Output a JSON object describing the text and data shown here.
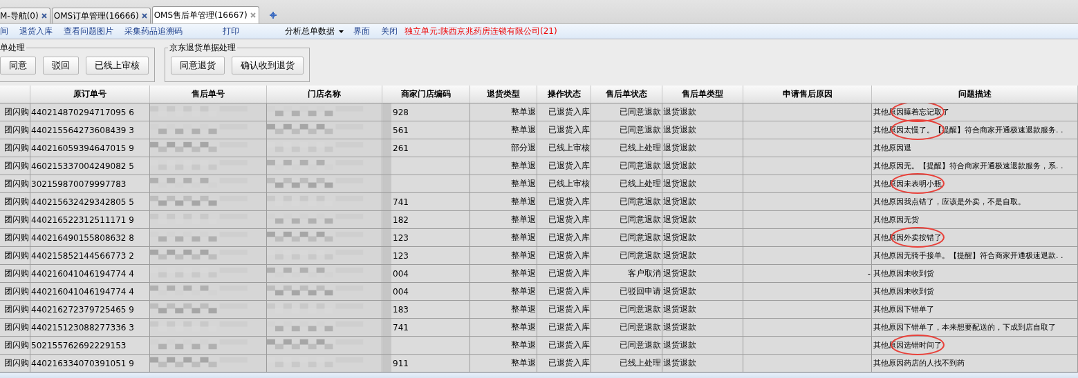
{
  "tabs": [
    {
      "label": "M-导航(0)",
      "selected": false,
      "closable": true
    },
    {
      "label": "OMS订单管理(16666)",
      "selected": false,
      "closable": true
    },
    {
      "label": "OMS售后单管理(16667)",
      "selected": true,
      "closable": true
    }
  ],
  "toolbar": [
    {
      "kind": "link",
      "label": "间"
    },
    {
      "kind": "link",
      "label": "退货入库"
    },
    {
      "kind": "link",
      "label": "查看问题图片"
    },
    {
      "kind": "link",
      "label": "采集药品追溯码"
    },
    {
      "kind": "gap"
    },
    {
      "kind": "link",
      "label": "打印"
    },
    {
      "kind": "gap"
    },
    {
      "kind": "dropdown",
      "label": "分析总单数据"
    },
    {
      "kind": "link",
      "label": "界面"
    },
    {
      "kind": "link",
      "label": "关闭"
    },
    {
      "kind": "notice",
      "label": "独立单元:陕西京兆药房连锁有限公司(21)"
    }
  ],
  "groups": [
    {
      "title": "单处理",
      "buttons": [
        "同意",
        "驳回",
        "已线上审核"
      ]
    },
    {
      "title": "京东退货单据处理",
      "buttons": [
        "同意退货",
        "确认收到退货"
      ]
    }
  ],
  "table": {
    "columns": [
      {
        "kind": "text"
      },
      {
        "label": "原订单号",
        "kind": "text"
      },
      {
        "label": "售后单号",
        "kind": "blurred"
      },
      {
        "label": "门店名称",
        "kind": "blurred"
      },
      {
        "label": "商家门店编码",
        "kind": "partial"
      },
      {
        "label": "退货类型",
        "kind": "text"
      },
      {
        "label": "操作状态",
        "kind": "text"
      },
      {
        "label": "售后单状态",
        "kind": "text"
      },
      {
        "label": "售后单类型",
        "kind": "text"
      },
      {
        "label": "申请售后原因",
        "kind": "text"
      },
      {
        "label": "问题描述",
        "kind": "text"
      }
    ],
    "rows": [
      {
        "cells": [
          "团闪购",
          "440214870294717095 6",
          "",
          "",
          "928",
          "整单退",
          "已退货入库",
          "已同意退款",
          "退货退款",
          "",
          "其他原因睡着忘记取了"
        ],
        "circled": true
      },
      {
        "cells": [
          "团闪购",
          "440215564273608439 3",
          "",
          "",
          "561",
          "整单退",
          "已退货入库",
          "已同意退款",
          "退货退款",
          "",
          "其他原因太慢了。【提醒】符合商家开通极速退款服务. ."
        ],
        "circled": true
      },
      {
        "cells": [
          "团闪购",
          "440216059394647015 9",
          "",
          "",
          "261",
          "部分退",
          "已线上审核",
          "已线上处理",
          "退货退款",
          "",
          "其他原因退"
        ]
      },
      {
        "cells": [
          "团闪购",
          "460215337004249082 5",
          "",
          "",
          "",
          "整单退",
          "已退货入库",
          "已同意退款",
          "退货退款",
          "",
          "其他原因无。【提醒】符合商家开通极速退款服务，系. ."
        ]
      },
      {
        "cells": [
          "团闪购",
          "302159870079997783",
          "",
          "",
          "",
          "整单退",
          "已线上审核",
          "已线上处理",
          "退货退款",
          "",
          "其他原因未表明小瓶"
        ],
        "circled": true
      },
      {
        "cells": [
          "团闪购",
          "440215632429342805 5",
          "",
          "",
          "741",
          "整单退",
          "已退货入库",
          "已同意退款",
          "退货退款",
          "",
          "其他原因我点错了，应该是外卖，不是自取。"
        ]
      },
      {
        "cells": [
          "团闪购",
          "440216522312511171 9",
          "",
          "",
          "182",
          "整单退",
          "已退货入库",
          "已同意退款",
          "退货退款",
          "",
          "其他原因无货"
        ]
      },
      {
        "cells": [
          "团闪购",
          "440216490155808632 8",
          "",
          "",
          "123",
          "整单退",
          "已退货入库",
          "已同意退款",
          "退货退款",
          "",
          "其他原因外卖按错了"
        ],
        "circled": true
      },
      {
        "cells": [
          "团闪购",
          "440215852144566773 2",
          "",
          "",
          "123",
          "整单退",
          "已退货入库",
          "已同意退款",
          "退货退款",
          "",
          "其他原因无骑手接单。【提醒】符合商家开通极速退款. ."
        ]
      },
      {
        "cells": [
          "团闪购",
          "440216041046194774 4",
          "",
          "",
          "004",
          "整单退",
          "已退货入库",
          "客户取消",
          "退货退款",
          "-",
          "其他原因未收到货"
        ]
      },
      {
        "cells": [
          "团闪购",
          "440216041046194774 4",
          "",
          "",
          "004",
          "整单退",
          "已退货入库",
          "已驳回申请",
          "退货退款",
          "",
          "其他原因未收到货"
        ]
      },
      {
        "cells": [
          "团闪购",
          "440216272379725465 9",
          "",
          "",
          "183",
          "整单退",
          "已退货入库",
          "已同意退款",
          "退货退款",
          "",
          "其他原因下错单了"
        ]
      },
      {
        "cells": [
          "团闪购",
          "440215123088277336 3",
          "",
          "",
          "741",
          "整单退",
          "已退货入库",
          "已同意退款",
          "退货退款",
          "",
          "其他原因下错单了，本来想要配送的，下成到店自取了"
        ]
      },
      {
        "cells": [
          "团闪购",
          "502155762692229153",
          "",
          "",
          "",
          "整单退",
          "已退货入库",
          "已同意退款",
          "退货退款",
          "",
          "其他原因选错时间了"
        ],
        "circled": true
      },
      {
        "cells": [
          "团闪购",
          "440216334070391051 9",
          "",
          "",
          "911",
          "整单退",
          "已退货入库",
          "已线上处理",
          "退货退款",
          "",
          "其他原因药店的人找不到药"
        ]
      }
    ]
  }
}
